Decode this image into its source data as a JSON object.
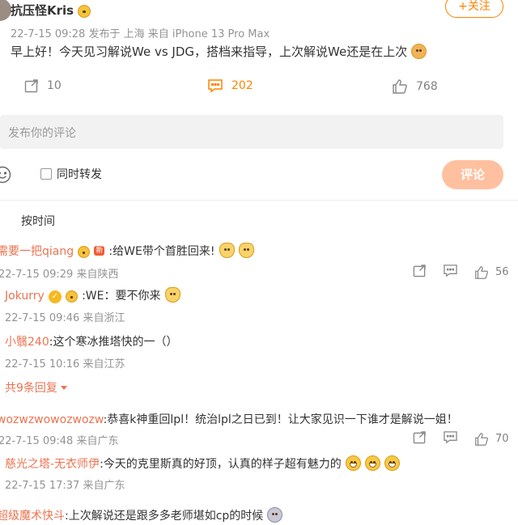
{
  "post": {
    "author": "抗压怪Kris",
    "follow_label": "+关注",
    "meta": "22-7-15 09:28  发布于 上海  来自 iPhone 13 Pro Max",
    "text": "早上好！今天见习解说We vs JDG，搭档来指导，上次解说We还是在上次",
    "repost_count": "10",
    "comment_count": "202",
    "like_count": "768"
  },
  "composer": {
    "placeholder": "发布你的评论",
    "repost_checkbox_label": "同时转发",
    "submit_label": "评论"
  },
  "sort_label": "按时间",
  "comments": [
    {
      "name": "需要一把qiang",
      "badge_new": "新",
      "text": ":给WE带个首胜回来!",
      "meta": "22-7-15 09:29  来自陕西",
      "like_count": "56",
      "replies": [
        {
          "name": "Jokurry",
          "text": ":WE：要不你来",
          "meta": "22-7-15 09:46  来自浙江"
        },
        {
          "name": "小翳240",
          "text": ":这个寒冰推塔快的一（）",
          "meta": "22-7-15 10:16  来自江苏"
        }
      ],
      "more_replies": "共9条回复"
    },
    {
      "name": "wozwzwowozwozw",
      "text": ":恭喜k神重回lpl！统治lpl之日已到！让大家见识一下谁才是解说一姐！",
      "meta": "22-7-15 09:48  来自广东",
      "like_count": "70",
      "replies": [
        {
          "name": "慈光之塔-无衣师伊",
          "text": ":今天的克里斯真的好顶，认真的样子超有魅力的",
          "meta": "22-7-15 17:37  来自广东"
        }
      ]
    },
    {
      "name": "超级魔术快斗",
      "text": ":上次解说还是跟多多老师堪如cp的时候"
    }
  ]
}
